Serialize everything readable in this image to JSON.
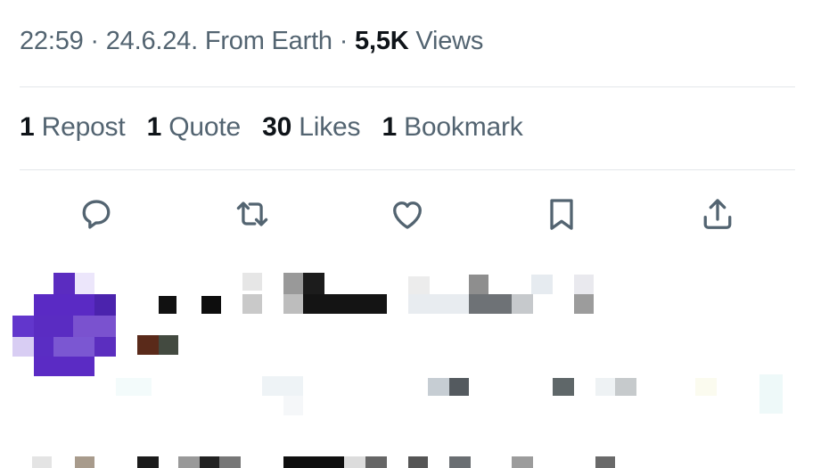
{
  "meta": {
    "time": "22:59",
    "sep1": " · ",
    "date": "24.6.24.",
    "source": " From Earth",
    "sep2": " · ",
    "views_count": "5,5K",
    "views_label": " Views"
  },
  "stats": [
    {
      "count": "1",
      "label": "Repost"
    },
    {
      "count": "1",
      "label": "Quote"
    },
    {
      "count": "30",
      "label": "Likes"
    },
    {
      "count": "1",
      "label": "Bookmark"
    }
  ],
  "actions": [
    {
      "icon": "reply-icon"
    },
    {
      "icon": "repost-icon"
    },
    {
      "icon": "like-icon"
    },
    {
      "icon": "bookmark-icon"
    },
    {
      "icon": "share-icon"
    }
  ],
  "colors": {
    "secondary_text": "#536471",
    "primary_text": "#0f1419",
    "divider": "#e3e7ea",
    "avatar_purple": "#5b2cc0"
  }
}
